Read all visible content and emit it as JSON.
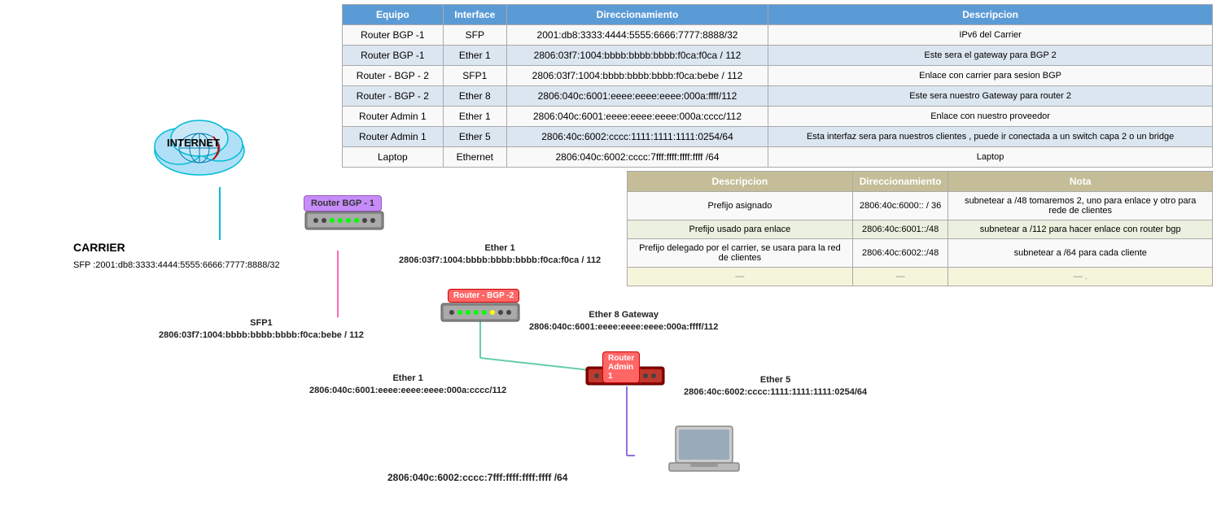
{
  "table": {
    "headers": [
      "Equipo",
      "Interface",
      "Direccionamiento",
      "Descripcion"
    ],
    "rows": [
      {
        "equipo": "Router BGP -1",
        "interface": "SFP",
        "dir": "2001:db8:3333:4444:5555:6666:7777:8888/32",
        "desc": "IPv6 del Carrier"
      },
      {
        "equipo": "Router BGP -1",
        "interface": "Ether 1",
        "dir": "2806:03f7:1004:bbbb:bbbb:bbbb:f0ca:f0ca / 112",
        "desc": "Este sera el gateway para BGP 2"
      },
      {
        "equipo": "Router - BGP - 2",
        "interface": "SFP1",
        "dir": "2806:03f7:1004:bbbb:bbbb:bbbb:f0ca:bebe / 112",
        "desc": "Enlace con carrier para sesion BGP"
      },
      {
        "equipo": "Router - BGP - 2",
        "interface": "Ether 8",
        "dir": "2806:040c:6001:eeee:eeee:eeee:000a:ffff/112",
        "desc": "Este sera nuestro Gateway para router 2"
      },
      {
        "equipo": "Router Admin 1",
        "interface": "Ether 1",
        "dir": "2806:040c:6001:eeee:eeee:eeee:000a:cccc/112",
        "desc": "Enlace con nuestro proveedor"
      },
      {
        "equipo": "Router Admin 1",
        "interface": "Ether 5",
        "dir": "2806:40c:6002:cccc:1111:1111:1111:0254/64",
        "desc": "Esta interfaz sera para nuestros clientes , puede ir conectada a un switch capa 2 o un bridge"
      },
      {
        "equipo": "Laptop",
        "interface": "Ethernet",
        "dir": "2806:040c:6002:cccc:7fff:ffff:ffff:ffff /64",
        "desc": "Laptop"
      }
    ]
  },
  "secondary_table": {
    "headers": [
      "Descripcion",
      "Direccionamiento",
      "Nota"
    ],
    "rows": [
      {
        "desc": "Prefijo asignado",
        "dir": "2806:40c:6000:: / 36",
        "nota": "subnetear a /48  tomaremos 2, uno para enlace y otro para rede de clientes"
      },
      {
        "desc": "Prefijo usado para enlace",
        "dir": "2806:40c:6001::/48",
        "nota": "subnetear a /112 para hacer enlace con router bgp"
      },
      {
        "desc": "Prefijo delegado por el carrier, se usara para la red de clientes",
        "dir": "2806:40c:6002::/48",
        "nota": "subnetear a /64 para cada cliente"
      },
      {
        "desc": "—",
        "dir": "—",
        "nota": "— ."
      }
    ]
  },
  "diagram": {
    "internet_label": "INTERNET",
    "carrier_label": "CARRIER",
    "carrier_sfp": "SFP :2001:db8:3333:4444:5555:6666:7777:8888/32",
    "router_bgp1_label": "Router BGP -\n1",
    "ether1_label": "Ether 1",
    "ether1_addr": "2806:03f7:1004:bbbb:bbbb:bbbb:f0ca:f0ca / 112",
    "router_bgp2_label": "Router - BGP -2",
    "sfp1_label": "SFP1",
    "sfp1_addr": "2806:03f7:1004:bbbb:bbbb:bbbb:f0ca:bebe / 112",
    "ether8_label": "Ether 8 Gateway",
    "ether8_addr": "2806:040c:6001:eeee:eeee:eeee:000a:ffff/112",
    "router_admin1_label": "Router Admin 1",
    "ether1_admin_label": "Ether 1",
    "ether1_admin_addr": "2806:040c:6001:eeee:eeee:eeee:000a:cccc/112",
    "ether5_label": "Ether 5",
    "ether5_addr": "2806:40c:6002:cccc:1111:1111:1111:0254/64",
    "laptop_addr": "2806:040c:6002:cccc:7fff:ffff:ffff:ffff /64"
  }
}
